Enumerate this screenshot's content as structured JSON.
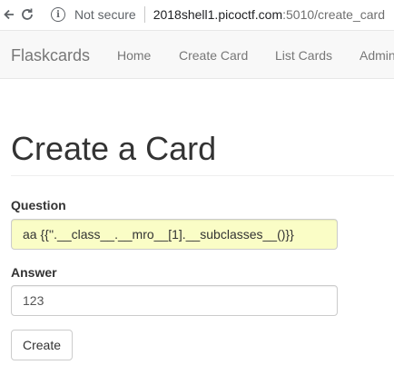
{
  "browser": {
    "security_label": "Not secure",
    "url_host": "2018shell1.picoctf.com",
    "url_rest": ":5010/create_card",
    "back_icon": "back-arrow-icon",
    "reload_icon": "reload-icon",
    "info_icon": "info-icon"
  },
  "navbar": {
    "brand": "Flaskcards",
    "links": [
      {
        "label": "Home"
      },
      {
        "label": "Create Card"
      },
      {
        "label": "List Cards"
      },
      {
        "label": "Admin"
      }
    ]
  },
  "page": {
    "title": "Create a Card"
  },
  "form": {
    "question_label": "Question",
    "question_value": "aa {{''.__class__.__mro__[1].__subclasses__()}}",
    "answer_label": "Answer",
    "answer_value": "123",
    "submit_label": "Create"
  },
  "colors": {
    "autofill_bg": "#fafdc6",
    "navbar_bg": "#f8f8f8",
    "nav_text": "#777777"
  }
}
